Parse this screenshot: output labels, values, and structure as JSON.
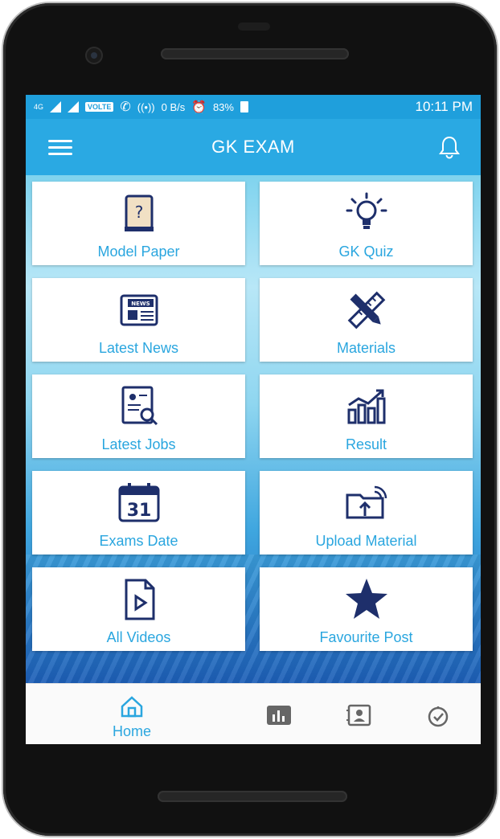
{
  "status_bar": {
    "network": "4G",
    "volte": "VOLTE",
    "data_rate": "0 B/s",
    "battery": "83%",
    "time": "10:11 PM"
  },
  "app_bar": {
    "title": "GK EXAM",
    "menu_icon": "hamburger-menu-icon",
    "notification_icon": "bell-icon"
  },
  "tiles": [
    {
      "label": "Model Paper",
      "icon": "question-paper-icon"
    },
    {
      "label": "GK Quiz",
      "icon": "lightbulb-icon"
    },
    {
      "label": "Latest News",
      "icon": "newspaper-icon"
    },
    {
      "label": "Materials",
      "icon": "pencil-ruler-icon"
    },
    {
      "label": "Latest Jobs",
      "icon": "job-search-icon"
    },
    {
      "label": "Result",
      "icon": "bar-chart-icon"
    },
    {
      "label": "Exams Date",
      "icon": "calendar-icon"
    },
    {
      "label": "Upload Material",
      "icon": "upload-folder-icon"
    },
    {
      "label": "All Videos",
      "icon": "video-file-icon"
    },
    {
      "label": "Favourite Post",
      "icon": "star-icon"
    }
  ],
  "calendar_day": "31",
  "news_badge": "NEWS",
  "bottom_nav": {
    "home_label": "Home",
    "items": [
      "home-icon",
      "stats-icon",
      "contacts-icon",
      "timer-icon"
    ]
  },
  "colors": {
    "primary": "#2aa9e3",
    "status_bar": "#1f9fdc",
    "icon_dark": "#1e2f6b",
    "label_blue": "#2aa6df"
  }
}
